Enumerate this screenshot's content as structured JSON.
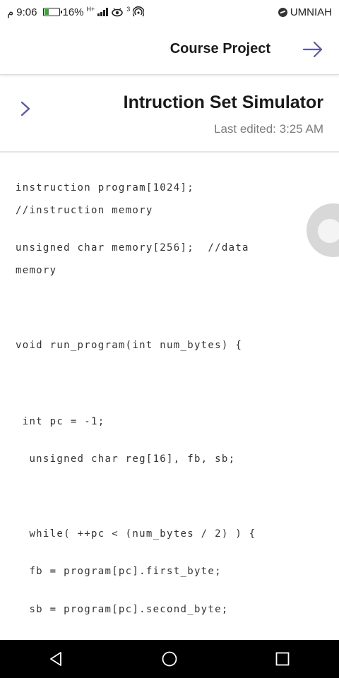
{
  "status_bar": {
    "time": "9:06",
    "rtl_mark": "م",
    "battery": "16%",
    "network": "H+",
    "extra": "3",
    "carrier": "UMNIAH"
  },
  "header": {
    "title": "Course Project"
  },
  "note": {
    "title": "Intruction Set Simulator",
    "subtitle": "Last edited: 3:25 AM"
  },
  "code_lines": [
    "instruction program[1024];",
    "//instruction memory",
    "unsigned char memory[256];  //data",
    "memory",
    "void run_program(int num_bytes) {",
    " int pc = -1;",
    "  unsigned char reg[16], fb, sb;",
    "  while( ++pc < (num_bytes / 2) ) {",
    "  fb = program[pc].first_byte;",
    "  sb = program[pc].second_byte;"
  ],
  "colors": {
    "accent": "#5c5a9e",
    "nav_bg": "#000000"
  },
  "icons": {
    "header_action": "arrow-right-icon",
    "back": "chevron-right-icon",
    "nav_back": "triangle-back-icon",
    "nav_home": "circle-home-icon",
    "nav_recent": "square-recent-icon"
  }
}
